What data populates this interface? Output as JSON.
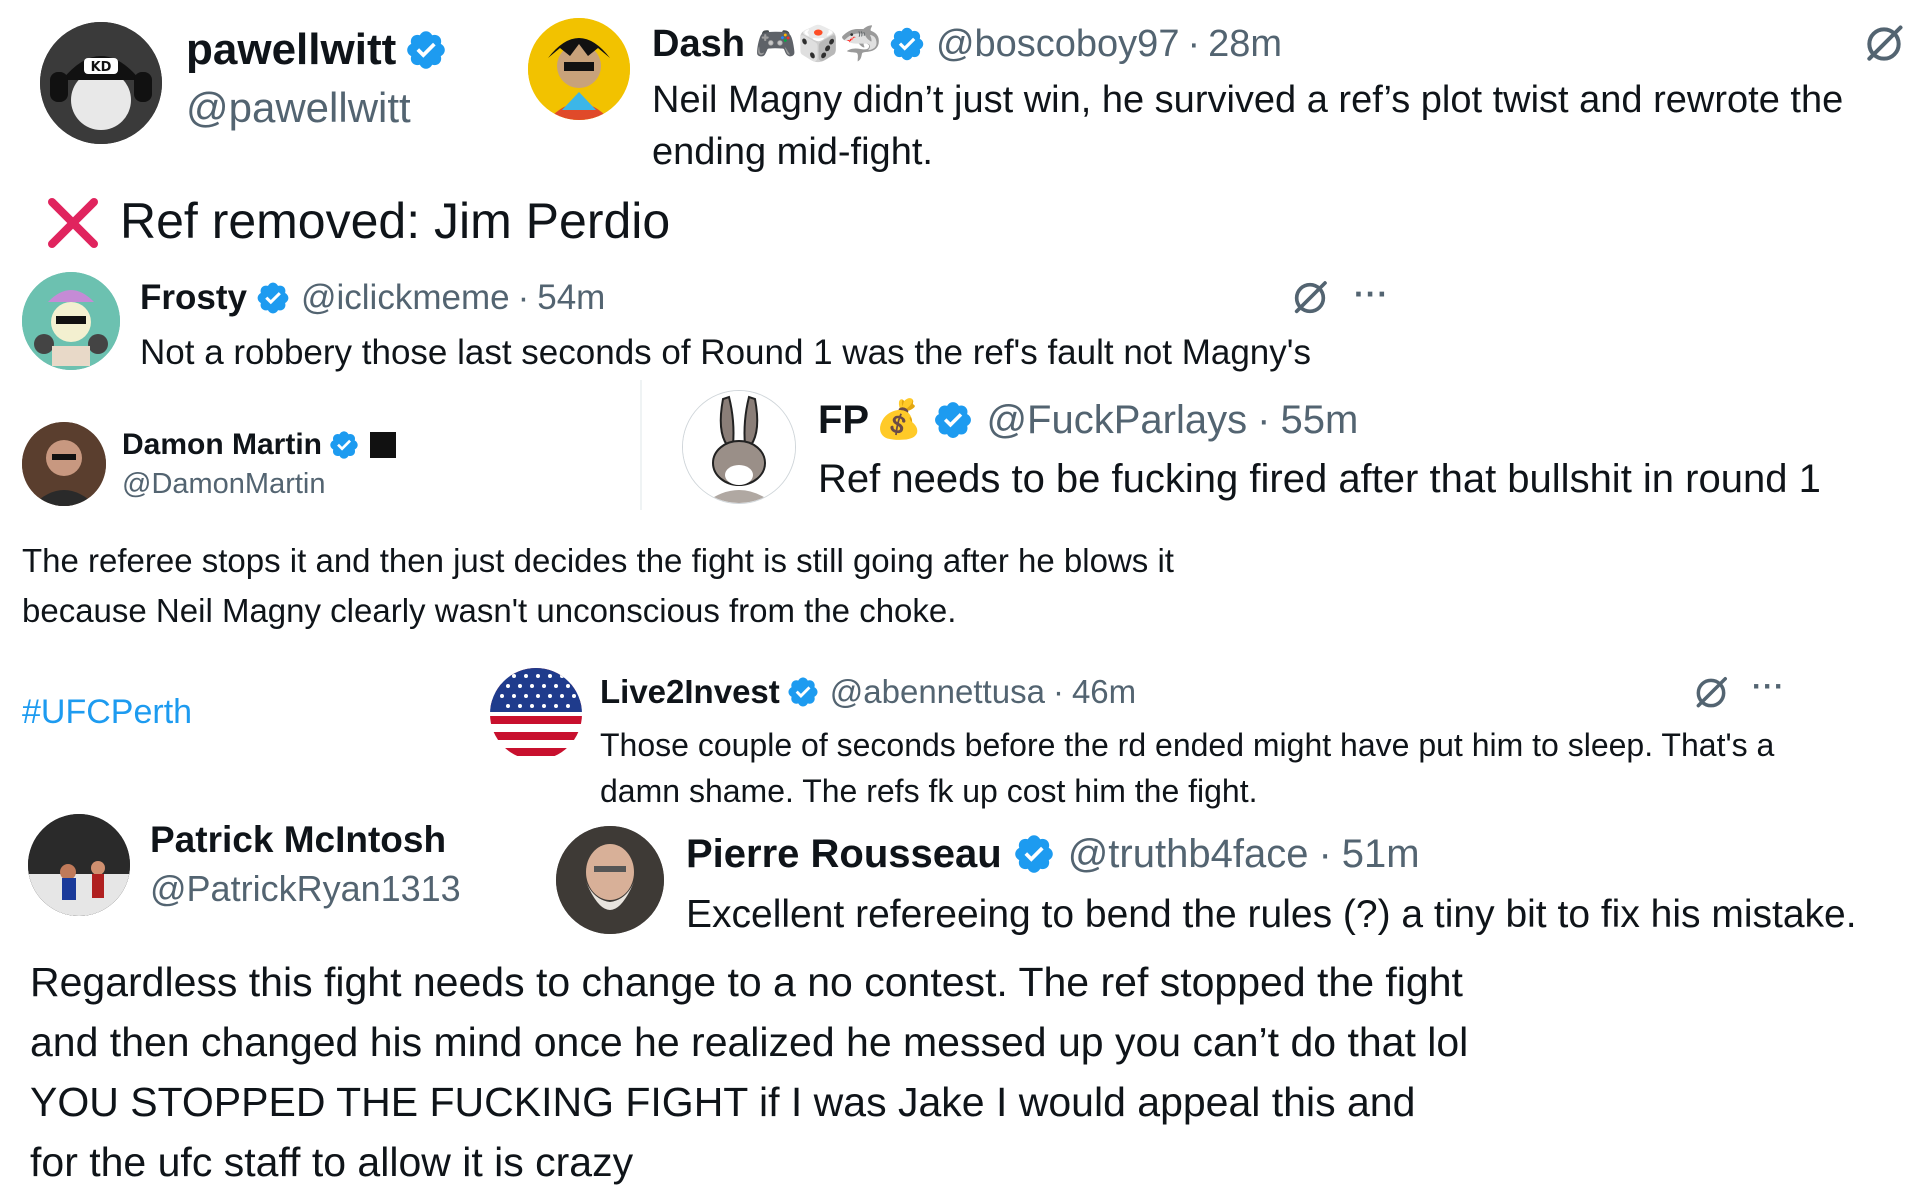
{
  "colors": {
    "verified": "#1d9bf0",
    "text": "#0f1419",
    "muted": "#536471",
    "hashtag": "#1d9bf0",
    "red_x": "#e0245e"
  },
  "tweets": {
    "pawellwitt": {
      "name": "pawellwitt",
      "handle": "@pawellwitt",
      "avatar_icon": "kd-cap-avatar"
    },
    "dash": {
      "name": "Dash",
      "emojis": "🎮🎲🦈",
      "handle": "@boscoboy97",
      "sep": "·",
      "time": "28m",
      "text": "Neil Magny didn’t just win, he survived a ref’s plot twist and rewrote the ending mid-fight."
    },
    "removed": {
      "icon": "red-x-icon",
      "text": "Ref removed: Jim Perdio"
    },
    "frosty": {
      "name": "Frosty",
      "handle": "@iclickmeme",
      "sep": "·",
      "time": "54m",
      "more": "···",
      "text": "Not a robbery those last seconds of Round 1 was the ref's fault not Magny's"
    },
    "damon": {
      "name": "Damon Martin",
      "handle": "@DamonMartin",
      "text": "The referee stops it and then just decides the fight is still going after he blows it because Neil Magny clearly wasn't unconscious from the choke.",
      "hashtag": "#UFCPerth"
    },
    "fp": {
      "name": "FP",
      "emoji": "💰",
      "handle": "@FuckParlays",
      "sep": "·",
      "time": "55m",
      "text": "Ref needs to be fucking fired after that bullshit in round 1"
    },
    "live2invest": {
      "name": "Live2Invest",
      "handle": "@abennettusa",
      "sep": "·",
      "time": "46m",
      "more": "···",
      "text": "Those couple of seconds before the rd ended might have put him to sleep. That's a damn shame. The refs fk up cost him the fight."
    },
    "patrick": {
      "name": "Patrick McIntosh",
      "handle": "@PatrickRyan1313",
      "text": "Regardless this fight needs to change to a no contest. The ref stopped the fight and then changed his mind once he realized he messed up you can’t do that lol YOU STOPPED THE FUCKING FIGHT if I was Jake I would appeal this and for the ufc staff to allow it is crazy"
    },
    "pierre": {
      "name": "Pierre Rousseau",
      "handle": "@truthb4face",
      "sep": "·",
      "time": "51m",
      "text": "Excellent refereeing to bend the rules (?) a tiny bit to fix his mistake."
    }
  }
}
